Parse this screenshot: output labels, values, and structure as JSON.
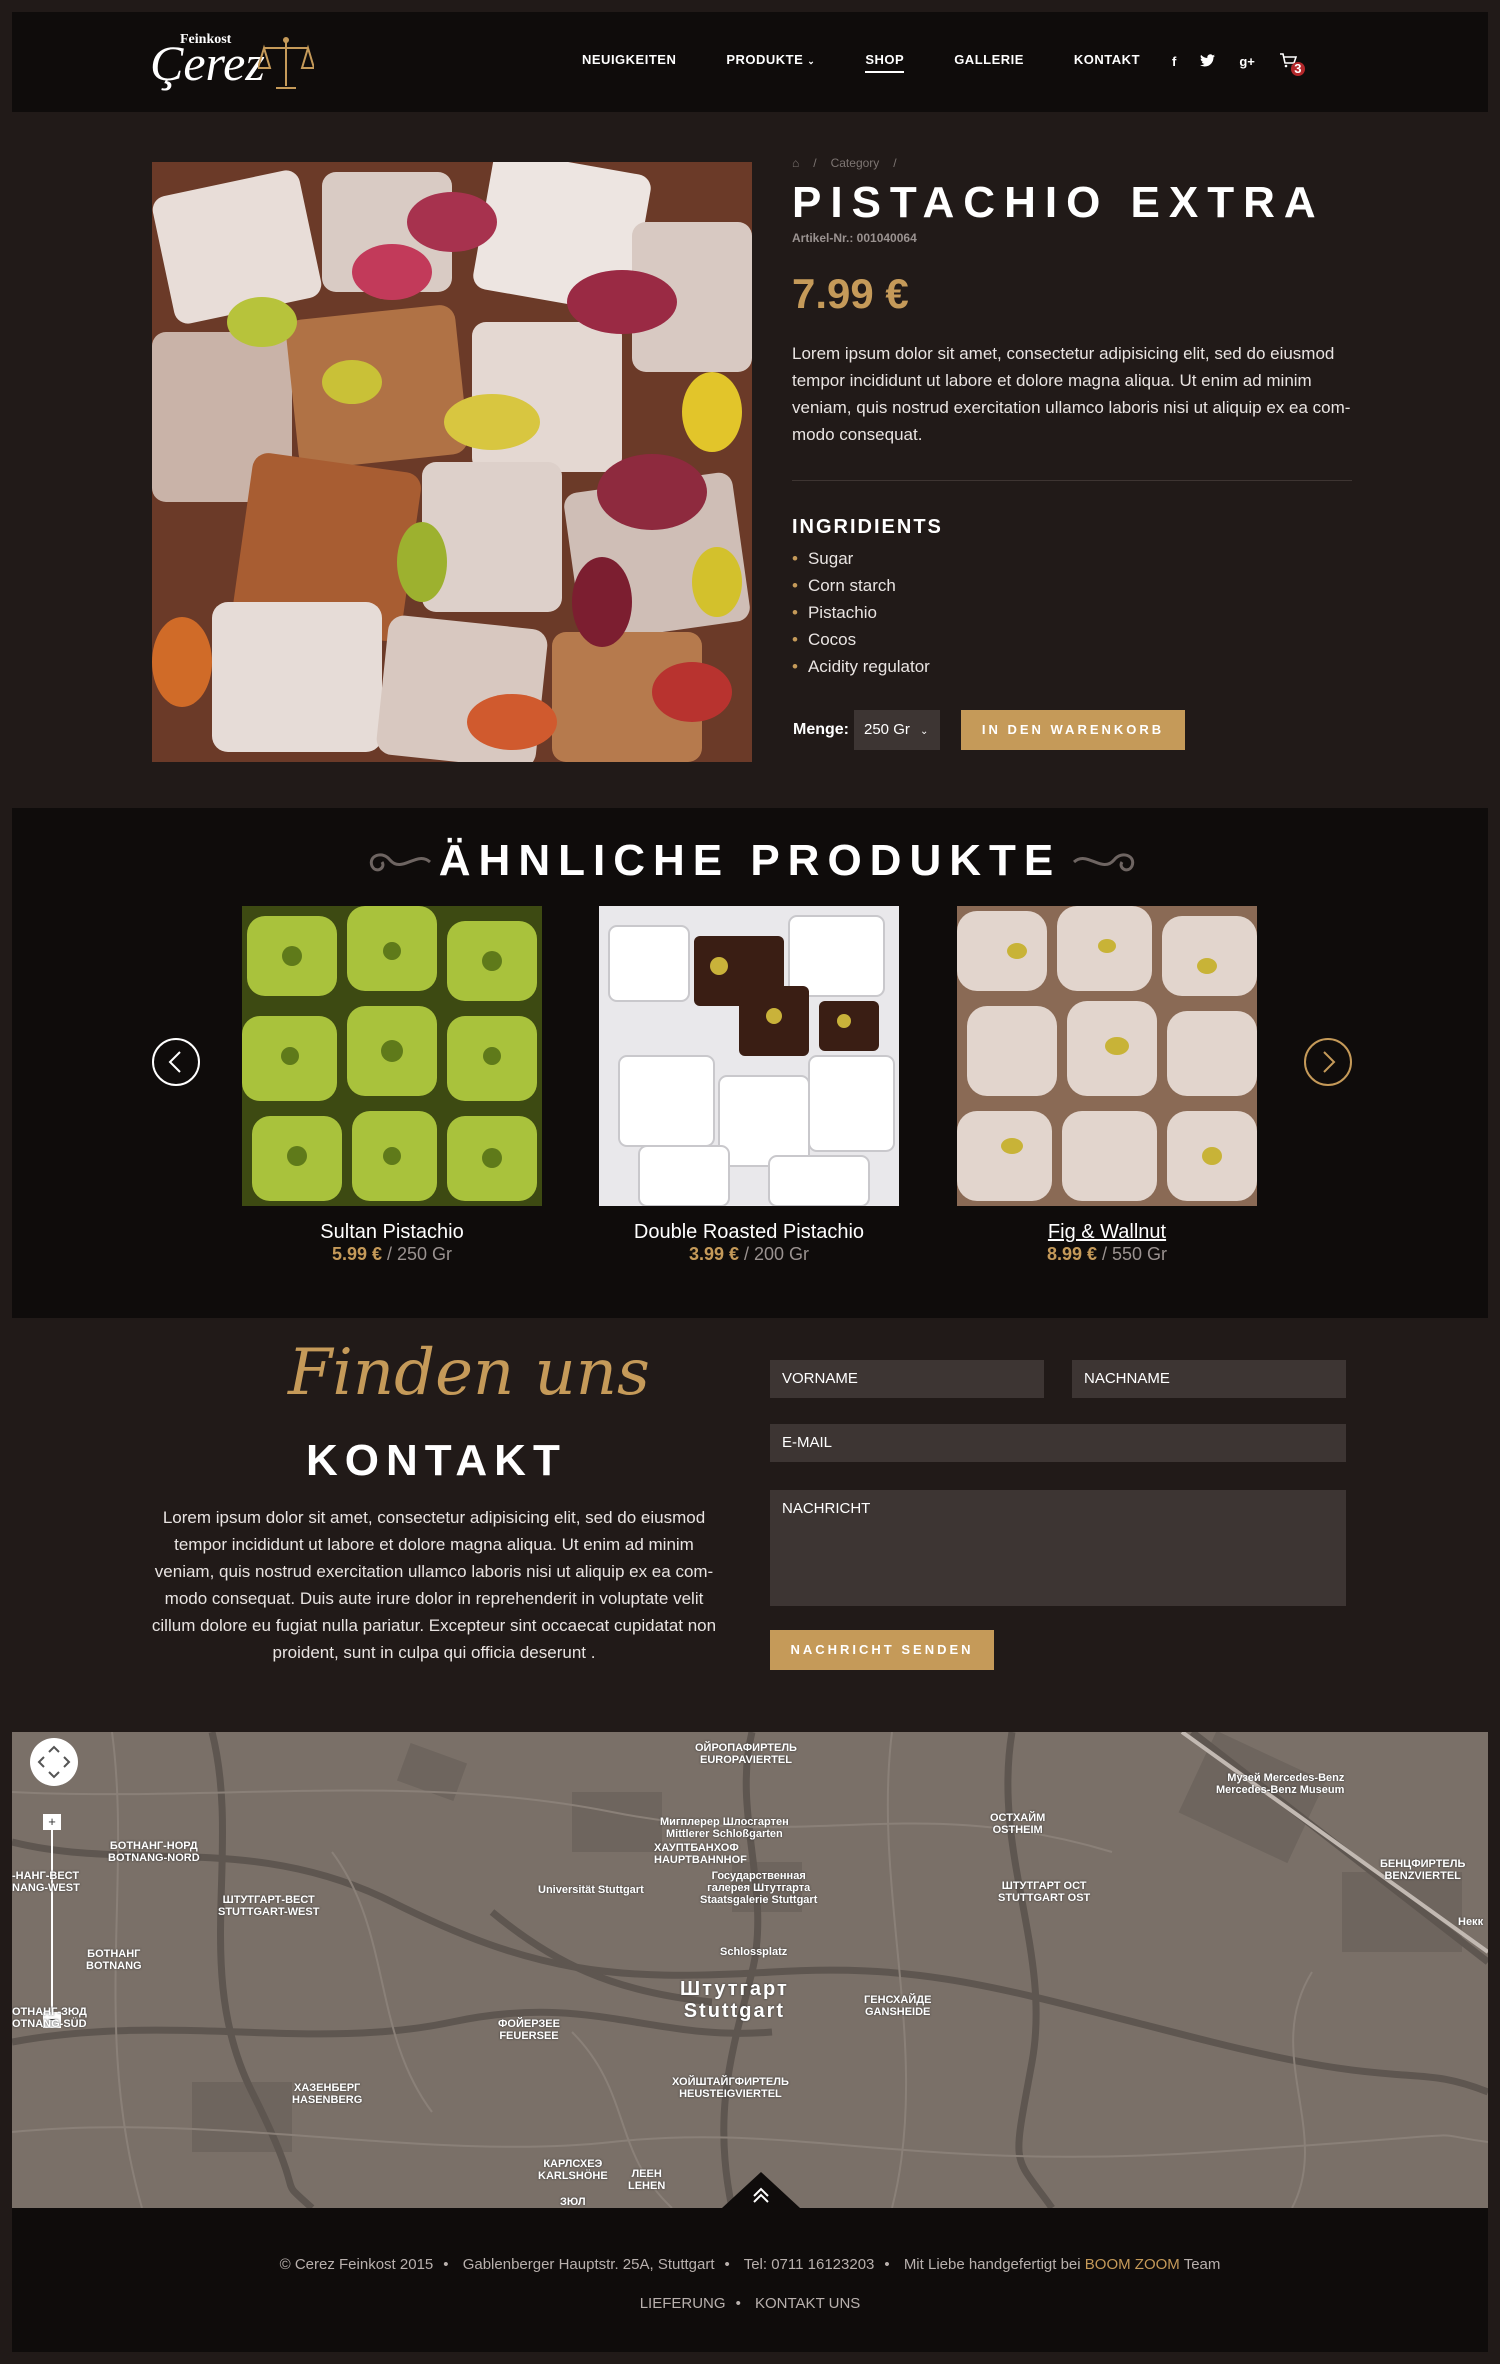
{
  "header": {
    "logo_small": "Feinkost",
    "logo_big": "Çerez",
    "nav": [
      "NEUIGKEITEN",
      "PRODUKTE",
      "SHOP",
      "GALLERIE",
      "KONTAKT"
    ],
    "social": [
      "f",
      "t",
      "g+"
    ],
    "cart_count": "3"
  },
  "product": {
    "breadcrumb": [
      "Category"
    ],
    "title": "PISTACHIO EXTRA",
    "sku": "Artikel-Nr.: 001040064",
    "price": "7.99 €",
    "description": "Lorem ipsum dolor sit amet, consectetur adipisicing elit, sed do eiusmod tempor incididunt ut labore et dolore magna aliqua. Ut enim ad minim veniam, quis nostrud exercitation ullamco laboris nisi ut aliquip ex ea com-modo consequat.",
    "ingredients_title": "INGRIDIENTS",
    "ingredients": [
      "Sugar",
      "Corn starch",
      "Pistachio",
      "Cocos",
      "Acidity regulator"
    ],
    "menge_label": "Menge:",
    "menge_value": "250 Gr",
    "cart_button": "IN DEN WARENKORB"
  },
  "similar": {
    "title": "ÄHNLICHE PRODUKTE",
    "items": [
      {
        "name": "Sultan Pistachio",
        "price": "5.99 €",
        "weight": "/ 250 Gr"
      },
      {
        "name": "Double Roasted Pistachio",
        "price": "3.99 €",
        "weight": "/ 200 Gr"
      },
      {
        "name": "Fig & Wallnut",
        "price": "8.99 €",
        "weight": "/ 550 Gr"
      }
    ]
  },
  "contact": {
    "script": "Finden uns",
    "title": "KONTAKT",
    "text": "Lorem ipsum dolor sit amet, consectetur adipisicing elit, sed do eiusmod tempor incididunt ut labore et dolore magna aliqua. Ut enim ad minim veniam, quis nostrud exercitation ullamco laboris nisi ut aliquip ex ea com-modo consequat. Duis aute irure dolor in reprehenderit in voluptate velit cillum dolore eu fugiat nulla pariatur. Excepteur sint occaecat cupidatat non proident, sunt in culpa qui officia deserunt .",
    "fields": {
      "firstname": "VORNAME",
      "lastname": "NACHNAME",
      "email": "E-MAIL",
      "message": "NACHRICHT"
    },
    "send_button": "NACHRICHT SENDEN"
  },
  "map": {
    "labels": [
      {
        "text": "ОЙРОПАФИРТЕЛЬ\nEUROPAVIERTEL"
      },
      {
        "text": "Мигплерер Шлосгартен\nMittlerer Schloßgarten"
      },
      {
        "text": "ХАУПТБАНХОФ\nHAUPTBAHNHOF"
      },
      {
        "text": "Universität Stuttgart"
      },
      {
        "text": "Государственная\nгалерея Штутгарта\nStaatsgalerie Stuttgart"
      },
      {
        "text": "Schlossplatz"
      },
      {
        "text": "ОСТХАЙМ\nOSTHEIM"
      },
      {
        "text": "Музей Mercedes-Benz\nMercedes-Benz Museum"
      },
      {
        "text": "БЕНЦФИРТЕЛЬ\nBENZVIERTEL"
      },
      {
        "text": "ШТУТГАРТ ОСТ\nSTUTTGART OST"
      },
      {
        "text": "БОТНАНГ-НОРД\nBOTNANG-NORD"
      },
      {
        "text": "ШТУТГАРТ-ВЕСТ\nSTUTTGART-WEST"
      },
      {
        "text": "БОТНАНГ\nBOTNANG"
      },
      {
        "text": "ГЕНСХАЙДЕ\nGANSHEIDE"
      },
      {
        "text": "ФОЙЕРЗЕЕ\nFEUERSEE"
      },
      {
        "text": "ХАЗЕНБЕРГ\nHASENBERG"
      },
      {
        "text": "ХОЙШТАЙГФИРТЕЛЬ\nHEUSTEIGVIERTEL"
      },
      {
        "text": "КАРЛСХЕЭ\nKARLSHÖHE"
      },
      {
        "text": "ЛЕЕН\nLEHEN"
      },
      {
        "text": "ЗЮЛ"
      },
      {
        "text": "-НАНГ-ВЕСТ\nNANG-WEST"
      },
      {
        "text": "ОТНАНГ-ЗЮД\nOTNANG-SÜD"
      },
      {
        "text": "Некк"
      }
    ],
    "city": "Штутгарт\nStuttgart",
    "zoom_plus": "+",
    "zoom_minus": "−"
  },
  "footer": {
    "copyright": "© Cerez Feinkost 2015",
    "address": "Gablenberger Hauptstr. 25A, Stuttgart",
    "phone": "Tel: 0711 16123203",
    "made_by_prefix": "Mit Liebe handgefertigt bei",
    "made_by_brand": "BOOM ZOOM",
    "made_by_suffix": "Team",
    "links": [
      "LIEFERUNG",
      "KONTAKT UNS"
    ]
  },
  "colors": {
    "accent": "#c59a59",
    "background": "#211a18",
    "panel": "#0f0c0b",
    "field": "#3d3533"
  },
  "icons": [
    "home-icon",
    "facebook-icon",
    "twitter-icon",
    "google-plus-icon",
    "cart-icon",
    "flourish-icon",
    "chevron-left-icon",
    "chevron-right-icon",
    "pan-control-icon",
    "scroll-top-icon"
  ]
}
